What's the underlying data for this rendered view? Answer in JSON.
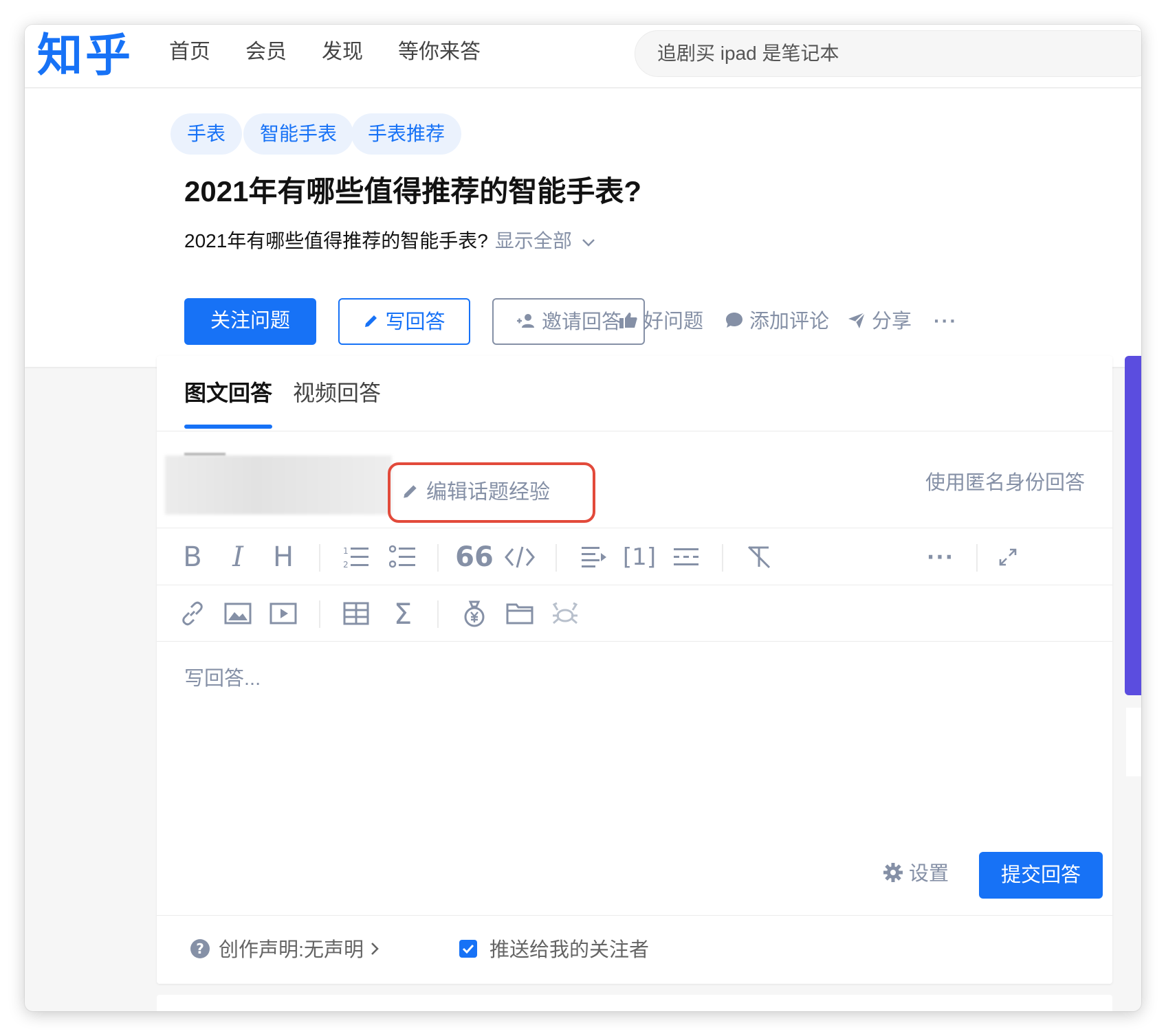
{
  "nav": {
    "logo": "知乎",
    "items": [
      "首页",
      "会员",
      "发现",
      "等你来答"
    ],
    "search_placeholder": "追剧买 ipad 是笔记本"
  },
  "question": {
    "tags": [
      "手表",
      "智能手表",
      "手表推荐"
    ],
    "title": "2021年有哪些值得推荐的智能手表?",
    "description": "2021年有哪些值得推荐的智能手表?",
    "show_all": "显示全部",
    "follow_label": "关注问题",
    "write_label": "写回答",
    "invite_label": "邀请回答",
    "good_label": "好问题",
    "comment_label": "添加评论",
    "share_label": "分享",
    "more_label": "···"
  },
  "editor": {
    "tabs": [
      "图文回答",
      "视频回答"
    ],
    "edit_experience_label": "编辑话题经验",
    "anonymous_label": "使用匿名身份回答",
    "toolbar1": [
      "bold-icon",
      "italic-icon",
      "heading-icon",
      "ordered-list-icon",
      "unordered-list-icon",
      "quote-icon",
      "code-icon",
      "align-icon",
      "reference-icon",
      "divider-icon",
      "clear-format-icon",
      "more-icon",
      "fullscreen-icon"
    ],
    "toolbar2": [
      "link-icon",
      "image-icon",
      "video-icon",
      "table-icon",
      "formula-icon",
      "money-bag-icon",
      "folder-icon",
      "crab-icon"
    ],
    "placeholder": "写回答...",
    "settings_label": "设置",
    "submit_label": "提交回答",
    "declaration_label": "创作声明:无声明",
    "push_label": "推送给我的关注者"
  },
  "colors": {
    "brand": "#1772f6",
    "muted": "#8590a6",
    "highlight": "#e24a3b",
    "sidebar_accent": "#5b4ddf"
  }
}
